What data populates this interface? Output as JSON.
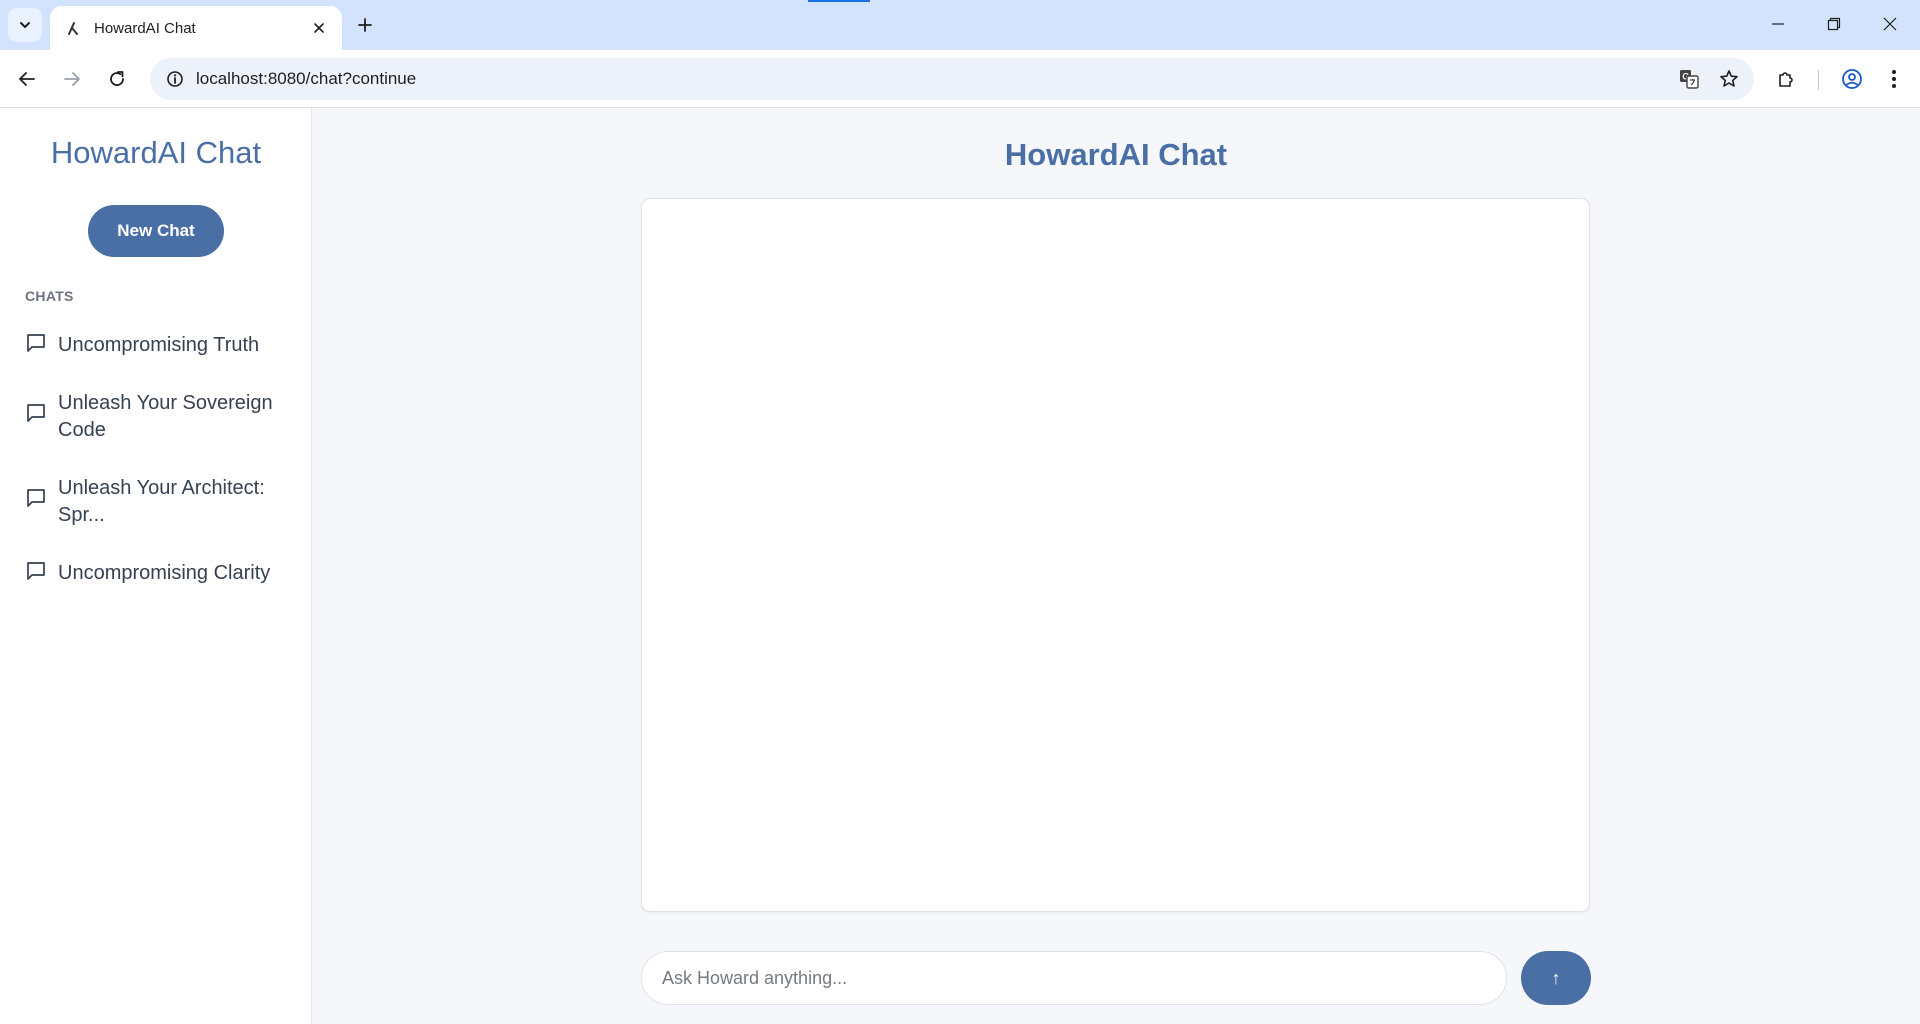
{
  "browser": {
    "tab_title": "HowardAI Chat",
    "url": "localhost:8080/chat?continue",
    "icons": {
      "tab_search": "chevron-down-icon",
      "favicon": "app-favicon-icon",
      "tab_close": "close-icon",
      "new_tab": "plus-icon",
      "back": "arrow-left-icon",
      "forward": "arrow-right-icon",
      "reload": "reload-icon",
      "site_info": "info-icon",
      "translate": "translate-icon",
      "bookmark": "star-icon",
      "extensions": "puzzle-icon",
      "profile": "profile-icon",
      "menu": "more-vert-icon",
      "minimize": "minimize-icon",
      "restore": "restore-icon",
      "close": "close-icon"
    }
  },
  "sidebar": {
    "brand": "HowardAI Chat",
    "new_chat_label": "New Chat",
    "section_heading": "CHATS",
    "items": [
      {
        "label": "Uncompromising Truth"
      },
      {
        "label": "Unleash Your Sovereign Code"
      },
      {
        "label": "Unleash Your Architect: Spr..."
      },
      {
        "label": "Uncompromising Clarity"
      }
    ]
  },
  "main": {
    "title": "HowardAI Chat",
    "input_placeholder": "Ask Howard anything...",
    "input_value": "",
    "send_label": "↑"
  },
  "colors": {
    "accent": "#4a6fa5",
    "page_background": "#f5f7fa",
    "tabbar": "#d3e3fd"
  }
}
